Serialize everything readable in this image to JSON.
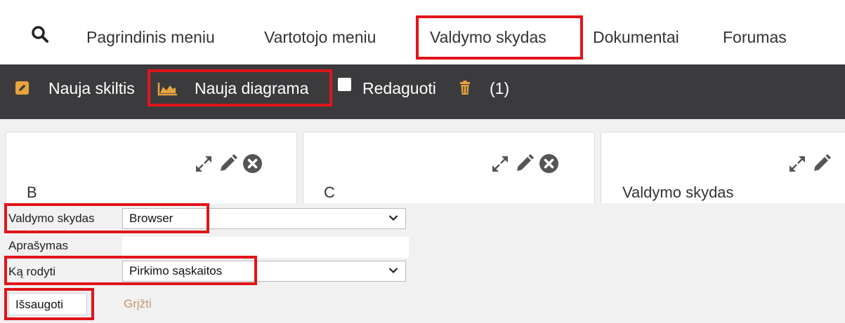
{
  "nav": {
    "items": [
      "Pagrindinis meniu",
      "Vartotojo meniu",
      "Valdymo skydas",
      "Dokumentai",
      "Forumas"
    ]
  },
  "toolbar": {
    "new_column": "Nauja skiltis",
    "new_chart": "Nauja diagrama",
    "edit": "Redaguoti",
    "trash_count": "(1)"
  },
  "tabs": [
    {
      "label": "B"
    },
    {
      "label": "C"
    },
    {
      "label": "Valdymo skydas"
    }
  ],
  "form": {
    "dashboard_label": "Valdymo skydas",
    "dashboard_value": "Browser",
    "description_label": "Aprašymas",
    "description_value": "",
    "show_label": "Ką rodyti",
    "show_value": "Pirkimo sąskaitos",
    "save_button": "Išsaugoti",
    "back_link": "Grįžti"
  },
  "colors": {
    "highlight": "#e0151b",
    "toolbar_bg": "#3b3b3e",
    "icon_orange": "#e8a33d"
  },
  "icons": [
    "search-icon",
    "edit-square-icon",
    "area-chart-icon",
    "trash-icon",
    "expand-icon",
    "pencil-icon",
    "close-circle-icon",
    "chevron-down-icon"
  ]
}
